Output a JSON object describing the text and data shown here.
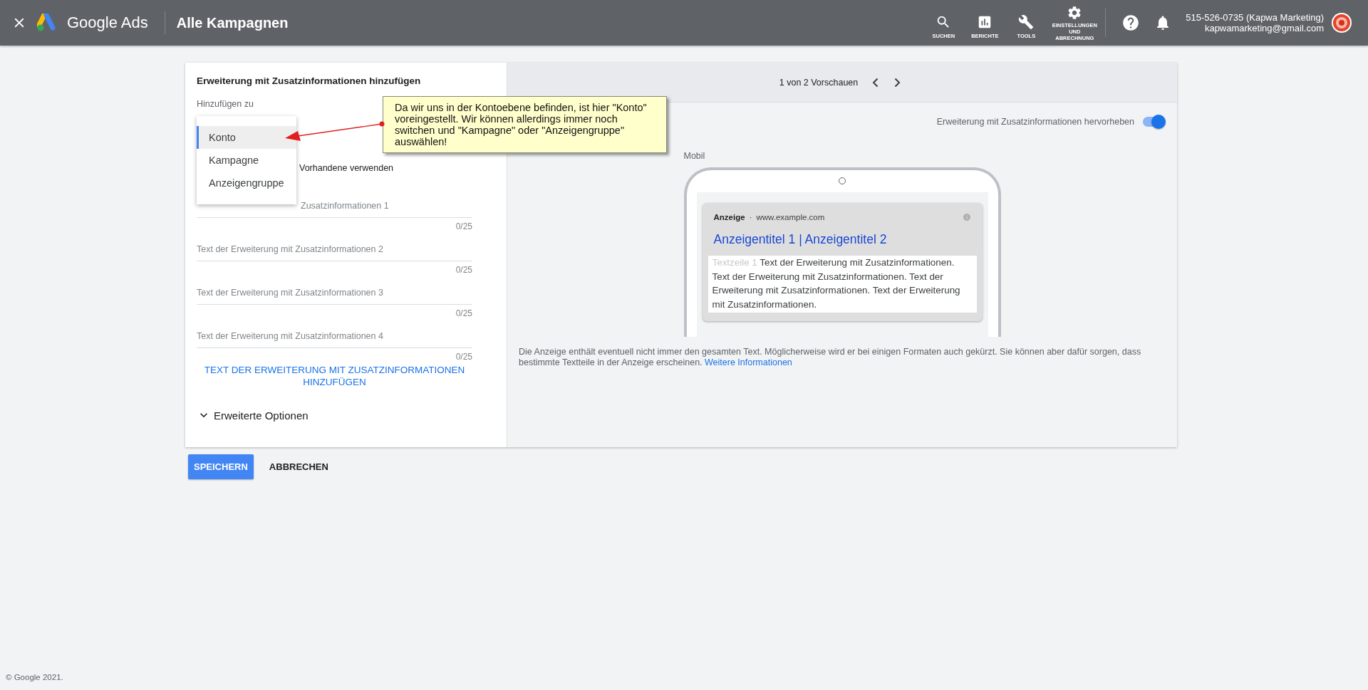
{
  "top_bar": {
    "brand": "Google Ads",
    "page_title": "Alle Kampagnen",
    "nav": [
      {
        "kind": "search",
        "label": "SUCHEN"
      },
      {
        "kind": "reports",
        "label": "BERICHTE"
      },
      {
        "kind": "tools",
        "label": "TOOLS"
      },
      {
        "kind": "settings",
        "label": "EINSTELLUNGEN UND ABRECHNUNG"
      }
    ],
    "account": {
      "name": "515-526-0735 (Kapwa Marketing)",
      "email": "kapwamarketing@gmail.com"
    }
  },
  "form": {
    "title": "Erweiterung mit Zusatzinformationen hinzufügen",
    "add_to_label": "Hinzufügen zu",
    "add_to_menu": [
      {
        "label": "Konto",
        "selected": true
      },
      {
        "label": "Kampagne",
        "selected": false
      },
      {
        "label": "Anzeigengruppe",
        "selected": false
      }
    ],
    "existing_option": "Vorhandene verwenden",
    "fields": [
      {
        "placeholder": "Zusatzinformationen 1",
        "counter": "0/25"
      },
      {
        "placeholder": "Text der Erweiterung mit Zusatzinformationen 2",
        "counter": "0/25"
      },
      {
        "placeholder": "Text der Erweiterung mit Zusatzinformationen 3",
        "counter": "0/25"
      },
      {
        "placeholder": "Text der Erweiterung mit Zusatzinformationen 4",
        "counter": "0/25"
      }
    ],
    "add_link": "TEXT DER ERWEITERUNG MIT ZUSATZINFORMATIONEN HINZUFÜGEN",
    "advanced": {
      "label": "Erweiterte Optionen",
      "expanded": false
    }
  },
  "annotation": {
    "text": "Da wir uns in der Kontoebene befinden, ist hier \"Konto\" voreingestellt. Wir können allerdings immer noch switchen und \"Kampagne\" oder \"Anzeigengruppe\" auswählen!"
  },
  "preview": {
    "pager": "1 von 2 Vorschauen",
    "highlight": {
      "label": "Erweiterung mit Zusatzinformationen hervorheben",
      "on": true
    },
    "device": "Mobil",
    "ad": {
      "badge": "Anzeige",
      "separator": "·",
      "url": "www.example.com",
      "headline": "Anzeigentitel 1 | Anzeigentitel 2",
      "body_label": "Textzeile 1",
      "body": "Text der Erweiterung mit Zusatzinformationen. Text der Erweiterung mit Zusatzinformationen. Text der Erweiterung mit Zusatzinformationen. Text der Erweiterung mit Zusatzinformationen."
    },
    "note": "Die Anzeige enthält eventuell nicht immer den gesamten Text. Möglicherweise wird er bei einigen Formaten auch gekürzt. Sie können aber dafür sorgen, dass bestimmte Textteile in der Anzeige erscheinen.",
    "note_link": "Weitere Informationen"
  },
  "actions": [
    {
      "kind": "primary",
      "label": "SPEICHERN"
    },
    {
      "kind": "text",
      "label": "ABBRECHEN"
    }
  ],
  "footer": "© Google 2021."
}
